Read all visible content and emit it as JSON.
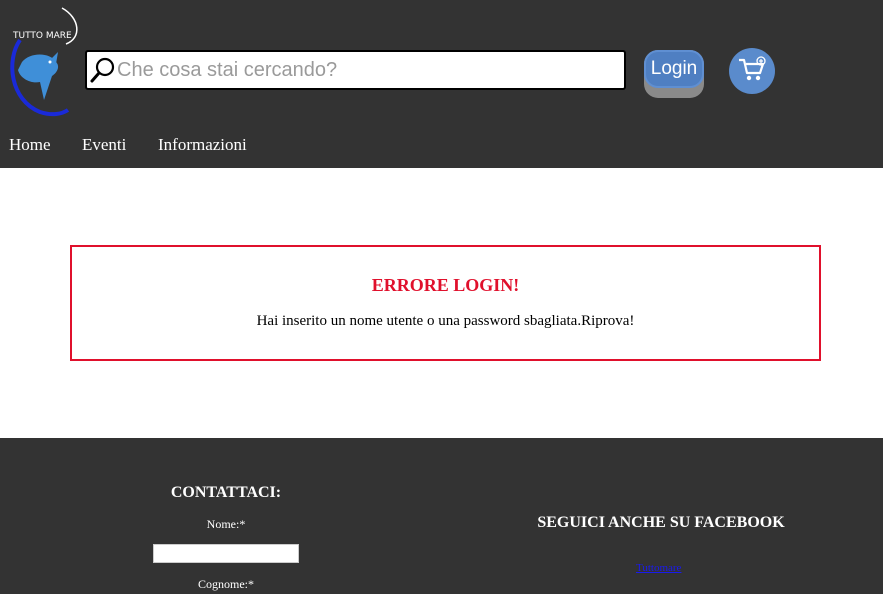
{
  "header": {
    "logo": {
      "text": "TUTTO MARE",
      "icon": "fish-logo-icon"
    },
    "search": {
      "placeholder": "Che cosa stai cercando?",
      "value": "",
      "icon": "search-icon"
    },
    "login_label": "Login",
    "cart_icon": "cart-add-icon",
    "colors": {
      "bar": "#333333",
      "button": "#4f7fc2",
      "cart": "#5a8bcc"
    }
  },
  "nav": {
    "items": [
      {
        "label": "Home"
      },
      {
        "label": "Eventi"
      },
      {
        "label": "Informazioni"
      }
    ]
  },
  "error": {
    "title": "ERRORE LOGIN!",
    "message": "Hai inserito un nome utente o una password sbagliata.Riprova!",
    "color": "#e0102c"
  },
  "footer": {
    "contact": {
      "title": "CONTATTACI:",
      "nome_label": "Nome:*",
      "nome_value": "",
      "cognome_label": "Cognome:*"
    },
    "facebook": {
      "title": "SEGUICI ANCHE SU FACEBOOK",
      "link_text": "Tuttomare"
    }
  }
}
